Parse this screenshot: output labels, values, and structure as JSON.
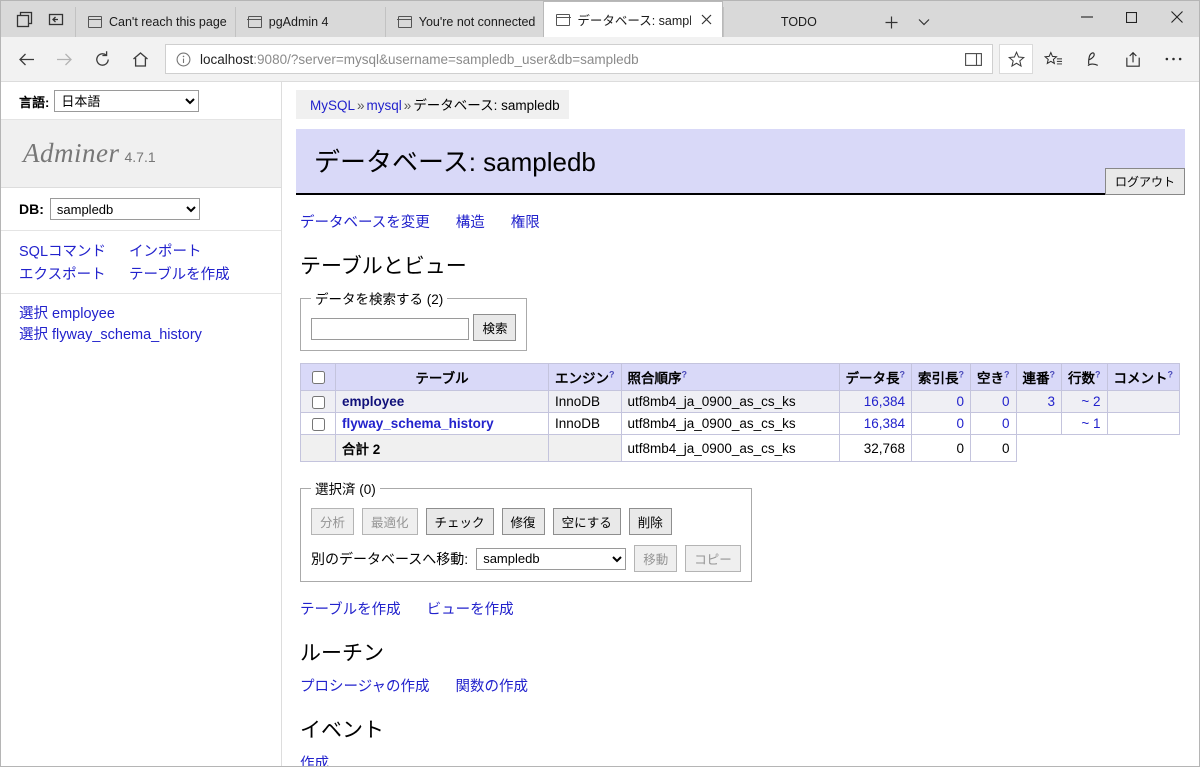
{
  "browser": {
    "tabs": [
      {
        "title": "Can't reach this page",
        "active": false,
        "closable": false
      },
      {
        "title": "pgAdmin 4",
        "active": false,
        "closable": false
      },
      {
        "title": "You're not connected",
        "active": false,
        "closable": false
      },
      {
        "title": "データベース: sampled",
        "active": true,
        "closable": true
      },
      {
        "title": "TODO",
        "active": false,
        "closable": false,
        "plain": true
      }
    ],
    "new_tab_label": "+",
    "tab_menu_icon": "chevron-down-icon",
    "window_controls": {
      "minimize": "—",
      "maximize": "□",
      "close": "✕"
    },
    "nav": {
      "back_icon": "back-arrow-icon",
      "forward_icon": "forward-arrow-icon",
      "refresh_icon": "refresh-icon",
      "home_icon": "home-icon",
      "info_icon": "info-icon",
      "url_host": "localhost",
      "url_rest": ":9080/?server=mysql&username=sampledb_user&db=sampledb",
      "reading_view_icon": "reading-view-icon",
      "favorite_icon": "star-icon",
      "reading_list_icon": "star-list-icon",
      "notes_icon": "pen-icon",
      "share_icon": "share-icon",
      "more_icon": "more-options-icon"
    }
  },
  "sidebar": {
    "language_label": "言語:",
    "language_value": "日本語",
    "language_options": [
      "日本語"
    ],
    "app_name": "Adminer",
    "app_version": "4.7.1",
    "db_label": "DB:",
    "db_value": "sampledb",
    "db_options": [
      "sampledb"
    ],
    "action_links": [
      "SQLコマンド",
      "インポート",
      "エクスポート",
      "テーブルを作成"
    ],
    "tables": [
      {
        "select_label": "選択",
        "name": "employee"
      },
      {
        "select_label": "選択",
        "name": "flyway_schema_history"
      }
    ]
  },
  "header": {
    "breadcrumb": [
      "MySQL",
      "mysql",
      "データベース: sampledb"
    ],
    "breadcrumb_separator": "»",
    "logout_label": "ログアウト",
    "page_title": "データベース: sampledb"
  },
  "main": {
    "top_links": [
      "データベースを変更",
      "構造",
      "権限"
    ],
    "tables_heading": "テーブルとビュー",
    "search": {
      "legend": "データを検索する (2)",
      "value": "",
      "placeholder": "",
      "button_label": "検索"
    },
    "table": {
      "columns": [
        {
          "label": "",
          "help": false
        },
        {
          "label": "テーブル",
          "help": false
        },
        {
          "label": "エンジン",
          "help": true
        },
        {
          "label": "照合順序",
          "help": true
        },
        {
          "label": "データ長",
          "help": true
        },
        {
          "label": "索引長",
          "help": true
        },
        {
          "label": "空き",
          "help": true
        },
        {
          "label": "連番",
          "help": true
        },
        {
          "label": "行数",
          "help": true
        },
        {
          "label": "コメント",
          "help": true
        }
      ],
      "rows": [
        {
          "name": "employee",
          "engine": "InnoDB",
          "collation": "utf8mb4_ja_0900_as_cs_ks",
          "data_length": "16,384",
          "index_length": "0",
          "free": "0",
          "auto_increment": "3",
          "rows": "~ 2",
          "comment": "",
          "hovered": true
        },
        {
          "name": "flyway_schema_history",
          "engine": "InnoDB",
          "collation": "utf8mb4_ja_0900_as_cs_ks",
          "data_length": "16,384",
          "index_length": "0",
          "free": "0",
          "auto_increment": "",
          "rows": "~ 1",
          "comment": "",
          "hovered": false
        }
      ],
      "total": {
        "label": "合計 2",
        "collation": "utf8mb4_ja_0900_as_cs_ks",
        "data_length": "32,768",
        "index_length": "0",
        "free": "0"
      }
    },
    "selected": {
      "legend": "選択済 (0)",
      "buttons": [
        {
          "label": "分析",
          "disabled": true
        },
        {
          "label": "最適化",
          "disabled": true
        },
        {
          "label": "チェック",
          "disabled": false
        },
        {
          "label": "修復",
          "disabled": false
        },
        {
          "label": "空にする",
          "disabled": false
        },
        {
          "label": "削除",
          "disabled": false
        }
      ],
      "move_label": "別のデータベースへ移動:",
      "move_db_value": "sampledb",
      "move_db_options": [
        "sampledb"
      ],
      "move_button": "移動",
      "copy_button": "コピー"
    },
    "create_links": [
      "テーブルを作成",
      "ビューを作成"
    ],
    "routines_heading": "ルーチン",
    "routine_links": [
      "プロシージャの作成",
      "関数の作成"
    ],
    "events_heading": "イベント",
    "event_links": [
      "作成"
    ]
  },
  "colors": {
    "accent_link": "#2222cc",
    "title_banner": "#d9d9f8",
    "table_header": "#d9d9f8",
    "chrome_tabstrip": "#d9d9d9"
  }
}
